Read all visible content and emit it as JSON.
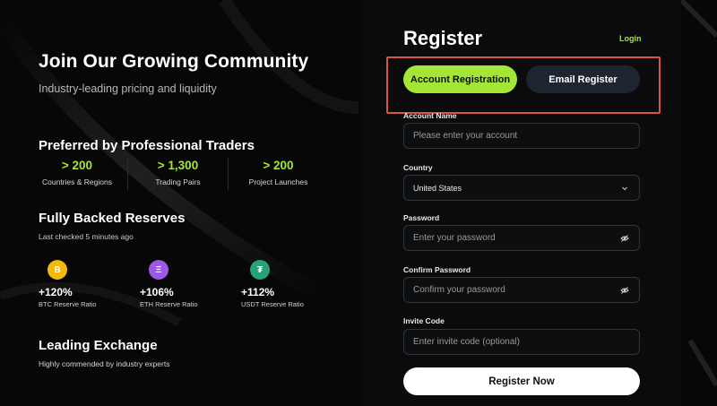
{
  "hero": {
    "title": "Join Our Growing Community",
    "subtitle": "Industry-leading pricing and liquidity"
  },
  "traders": {
    "title": "Preferred by Professional Traders",
    "stats": [
      {
        "value": "> 200",
        "label": "Countries & Regions"
      },
      {
        "value": "> 1,300",
        "label": "Trading Pairs"
      },
      {
        "value": "> 200",
        "label": "Project Launches"
      }
    ]
  },
  "reserves": {
    "title": "Fully Backed Reserves",
    "last_checked": "Last checked 5 minutes ago",
    "items": [
      {
        "symbol": "B",
        "icon": "bitcoin-icon",
        "color": "#f0b90b",
        "percent": "+120%",
        "label": "BTC Reserve Ratio"
      },
      {
        "symbol": "Ξ",
        "icon": "ethereum-icon",
        "color": "#9b59e6",
        "percent": "+106%",
        "label": "ETH Reserve Ratio"
      },
      {
        "symbol": "₮",
        "icon": "tether-icon",
        "color": "#26a17b",
        "percent": "+112%",
        "label": "USDT Reserve Ratio"
      }
    ]
  },
  "exchange": {
    "title": "Leading Exchange",
    "subtitle": "Highly commended by industry experts"
  },
  "form": {
    "title": "Register",
    "login_link": "Login",
    "tabs": {
      "account": "Account Registration",
      "email": "Email Register"
    },
    "account_label": "Account Name",
    "account_placeholder": "Please enter your account",
    "country_label": "Country",
    "country_value": "United States",
    "password_label": "Password",
    "password_placeholder": "Enter your password",
    "confirm_label": "Confirm Password",
    "confirm_placeholder": "Confirm your password",
    "invite_label": "Invite Code",
    "invite_placeholder": "Enter invite code (optional)",
    "submit": "Register Now"
  },
  "colors": {
    "accent": "#a3e635",
    "highlight_box": "#d9534f"
  }
}
